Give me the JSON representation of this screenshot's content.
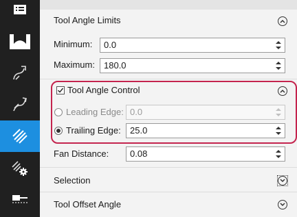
{
  "sections": {
    "tool_angle_limits": {
      "title": "Tool Angle Limits",
      "minimum_label": "Minimum:",
      "minimum_value": "0.0",
      "maximum_label": "Maximum:",
      "maximum_value": "180.0"
    },
    "tool_angle_control": {
      "title": "Tool Angle Control",
      "checked": true,
      "leading_edge_label": "Leading Edge:",
      "leading_edge_value": "0.0",
      "trailing_edge_label": "Trailing Edge:",
      "trailing_edge_value": "25.0",
      "selected_mode": "trailing-edge"
    },
    "fan_distance": {
      "label": "Fan Distance:",
      "value": "0.08"
    },
    "selection": {
      "title": "Selection"
    },
    "tool_offset_angle": {
      "title": "Tool Offset Angle"
    }
  },
  "toolbar": {
    "items": [
      "list-icon",
      "cup-shape-icon",
      "curve-tool-icon",
      "curve-path-icon",
      "parallel-lines-icon",
      "lines-gear-icon",
      "tool-offset-icon"
    ],
    "active_item": "parallel-lines-icon",
    "active_color": "#1d8fe0"
  },
  "highlight_color": "#c4234d"
}
